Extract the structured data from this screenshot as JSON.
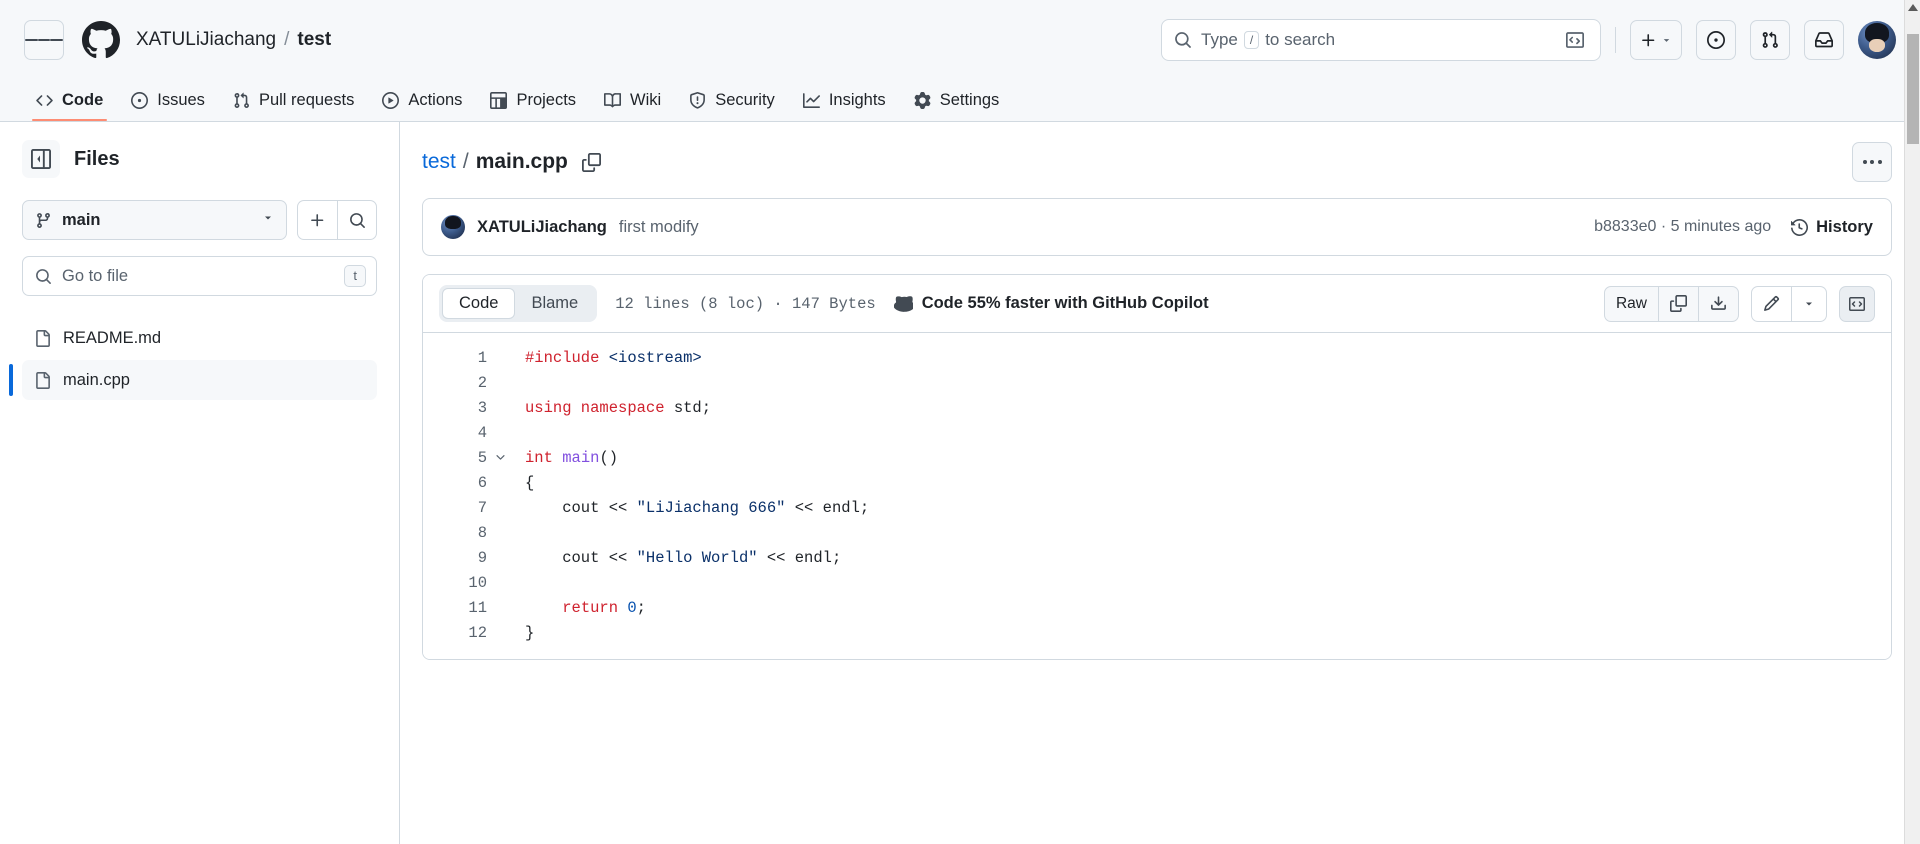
{
  "header": {
    "menu_icon": "hamburger-icon",
    "logo_icon": "github-logo-icon",
    "owner": "XATULiJiachang",
    "separator": "/",
    "repo": "test",
    "search": {
      "placeholder_prefix": "Type",
      "slash_key": "/",
      "placeholder_suffix": "to search",
      "search_icon": "search-icon",
      "command_icon": "terminal-icon"
    },
    "actions": {
      "create_new_label": "+",
      "create_new_caret": "▾",
      "issues_icon": "issue-opened-icon",
      "pull_requests_icon": "git-pull-request-icon",
      "inbox_icon": "inbox-icon",
      "avatar": "user-avatar"
    }
  },
  "repo_nav": {
    "tabs": [
      {
        "label": "Code",
        "icon": "code-icon",
        "active": true
      },
      {
        "label": "Issues",
        "icon": "issue-opened-icon",
        "active": false
      },
      {
        "label": "Pull requests",
        "icon": "git-pull-request-icon",
        "active": false
      },
      {
        "label": "Actions",
        "icon": "play-icon",
        "active": false
      },
      {
        "label": "Projects",
        "icon": "table-icon",
        "active": false
      },
      {
        "label": "Wiki",
        "icon": "book-icon",
        "active": false
      },
      {
        "label": "Security",
        "icon": "shield-icon",
        "active": false
      },
      {
        "label": "Insights",
        "icon": "graph-icon",
        "active": false
      },
      {
        "label": "Settings",
        "icon": "gear-icon",
        "active": false
      }
    ],
    "active_underline_color": "#fd8c73"
  },
  "sidebar": {
    "title": "Files",
    "toggle_icon": "sidebar-collapse-icon",
    "branch": {
      "name": "main",
      "icon": "git-branch-icon",
      "caret": "▾"
    },
    "add_button_icon": "plus-icon",
    "search_button_icon": "search-icon",
    "go_to_file": {
      "placeholder": "Go to file",
      "icon": "search-icon",
      "shortcut_key": "t"
    },
    "files": [
      {
        "name": "README.md",
        "icon": "file-icon",
        "selected": false
      },
      {
        "name": "main.cpp",
        "icon": "file-icon",
        "selected": true
      }
    ],
    "selected_accent": "#0969da"
  },
  "main": {
    "breadcrumb": {
      "repo": "test",
      "separator": "/",
      "file": "main.cpp",
      "copy_icon": "copy-path-icon"
    },
    "kebab_menu": "more-options-icon",
    "commit": {
      "author": "XATULiJiachang",
      "message": "first modify",
      "sha": "b8833e0",
      "sha_separator": "·",
      "time": "5 minutes ago",
      "history_label": "History",
      "history_icon": "history-icon"
    },
    "code_toolbar": {
      "tabs": [
        {
          "label": "Code",
          "active": true
        },
        {
          "label": "Blame",
          "active": false
        }
      ],
      "stats": "12 lines (8 loc) · 147 Bytes",
      "copilot_text": "Code 55% faster with GitHub Copilot",
      "copilot_icon": "copilot-icon",
      "raw_label": "Raw",
      "copy_icon": "copy-icon",
      "download_icon": "download-icon",
      "edit_icon": "pencil-icon",
      "edit_caret": "▾",
      "symbols_icon": "code-brackets-icon"
    },
    "code": {
      "language": "cpp",
      "lines": [
        {
          "n": "1",
          "fold": false,
          "tokens": [
            {
              "t": "#include ",
              "c": "tk-pre"
            },
            {
              "t": "<iostream>",
              "c": "tk-str"
            }
          ]
        },
        {
          "n": "2",
          "fold": false,
          "tokens": []
        },
        {
          "n": "3",
          "fold": false,
          "tokens": [
            {
              "t": "using namespace ",
              "c": "tk-kw"
            },
            {
              "t": "std",
              "c": "tk-id"
            },
            {
              "t": ";",
              "c": "tk-id"
            }
          ]
        },
        {
          "n": "4",
          "fold": false,
          "tokens": []
        },
        {
          "n": "5",
          "fold": true,
          "tokens": [
            {
              "t": "int ",
              "c": "tk-kw"
            },
            {
              "t": "main",
              "c": "tk-fn"
            },
            {
              "t": "()",
              "c": "tk-id"
            }
          ]
        },
        {
          "n": "6",
          "fold": false,
          "tokens": [
            {
              "t": "{",
              "c": "tk-id"
            }
          ]
        },
        {
          "n": "7",
          "fold": false,
          "tokens": [
            {
              "t": "    cout << ",
              "c": "tk-id"
            },
            {
              "t": "\"LiJiachang 666\"",
              "c": "tk-str"
            },
            {
              "t": " << endl;",
              "c": "tk-id"
            }
          ]
        },
        {
          "n": "8",
          "fold": false,
          "tokens": []
        },
        {
          "n": "9",
          "fold": false,
          "tokens": [
            {
              "t": "    cout << ",
              "c": "tk-id"
            },
            {
              "t": "\"Hello World\"",
              "c": "tk-str"
            },
            {
              "t": " << endl;",
              "c": "tk-id"
            }
          ]
        },
        {
          "n": "10",
          "fold": false,
          "tokens": []
        },
        {
          "n": "11",
          "fold": false,
          "tokens": [
            {
              "t": "    ",
              "c": "tk-id"
            },
            {
              "t": "return ",
              "c": "tk-kw"
            },
            {
              "t": "0",
              "c": "tk-num"
            },
            {
              "t": ";",
              "c": "tk-id"
            }
          ]
        },
        {
          "n": "12",
          "fold": false,
          "tokens": [
            {
              "t": "}",
              "c": "tk-id"
            }
          ]
        }
      ]
    },
    "floating_button": {
      "icon": "command-icon",
      "glyph": "⌘",
      "color": "#4493f8"
    }
  }
}
